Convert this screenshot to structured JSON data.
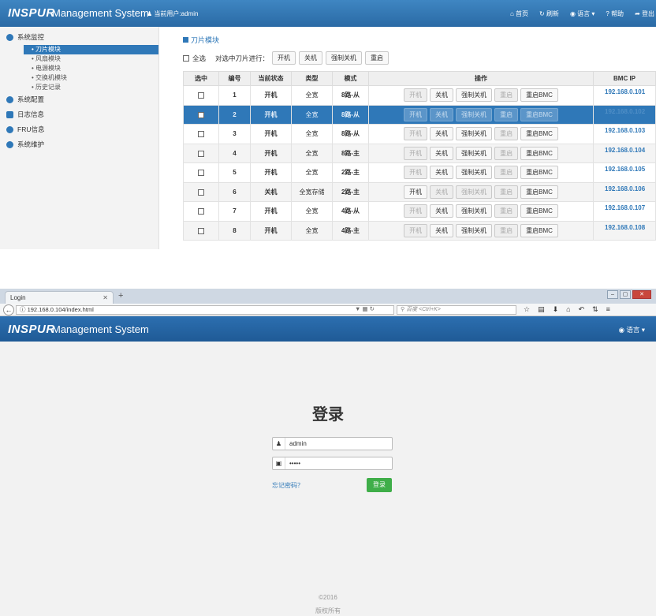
{
  "top": {
    "brand": "INSPUR",
    "brand_rest": "Management System",
    "current_user": "当前用户:admin",
    "nav": [
      "首页",
      "刷新",
      "语言",
      "帮助",
      "登出"
    ],
    "sidebar": {
      "groups": [
        {
          "label": "系统监控",
          "color": "#2f78b8",
          "subs": [
            "刀片模块",
            "风扇模块",
            "电源模块",
            "交换机模块",
            "历史记录"
          ],
          "active": "刀片模块"
        },
        {
          "label": "系统配置",
          "color": "#2f78b8"
        },
        {
          "label": "日志信息",
          "color": "#2f78b8"
        },
        {
          "label": "FRU信息",
          "color": "#2f78b8"
        },
        {
          "label": "系统维护",
          "color": "#2f78b8"
        }
      ]
    },
    "section_title": "刀片模块",
    "select_all": "全选",
    "batch_label": "对选中刀片进行：",
    "batch_buttons": [
      "开机",
      "关机",
      "强制关机",
      "重启"
    ],
    "table": {
      "headers": [
        "选中",
        "编号",
        "当前状态",
        "类型",
        "模式",
        "操作",
        "BMC IP"
      ],
      "op_labels": [
        "开机",
        "关机",
        "强制关机",
        "重启",
        "重启BMC"
      ],
      "rows": [
        {
          "no": "1",
          "status": "开机",
          "type": "全宽",
          "mode": "8路-从",
          "ip": "192.168.0.101"
        },
        {
          "no": "2",
          "status": "开机",
          "type": "全宽",
          "mode": "8路-从",
          "ip": "192.168.0.102",
          "selected": true
        },
        {
          "no": "3",
          "status": "开机",
          "type": "全宽",
          "mode": "8路-从",
          "ip": "192.168.0.103"
        },
        {
          "no": "4",
          "status": "开机",
          "type": "全宽",
          "mode": "8路-主",
          "ip": "192.168.0.104"
        },
        {
          "no": "5",
          "status": "开机",
          "type": "全宽",
          "mode": "2路-主",
          "ip": "192.168.0.105"
        },
        {
          "no": "6",
          "status": "关机",
          "type": "全宽存储",
          "mode": "2路-主",
          "ip": "192.168.0.106"
        },
        {
          "no": "7",
          "status": "开机",
          "type": "全宽",
          "mode": "4路-从",
          "ip": "192.168.0.107"
        },
        {
          "no": "8",
          "status": "开机",
          "type": "全宽",
          "mode": "4路-主",
          "ip": "192.168.0.108"
        }
      ]
    }
  },
  "browser": {
    "tab_title": "Login",
    "url": "192.168.0.104/index.html",
    "search_placeholder": "百度 <Ctrl+K>"
  },
  "login": {
    "brand": "INSPUR",
    "brand_rest": "Management System",
    "language": "语言",
    "title": "登录",
    "username": "admin",
    "password": "•••••",
    "forgot": "忘记密码？",
    "submit": "登录",
    "footer_year": "©2016",
    "footer_rights": "版权所有"
  }
}
